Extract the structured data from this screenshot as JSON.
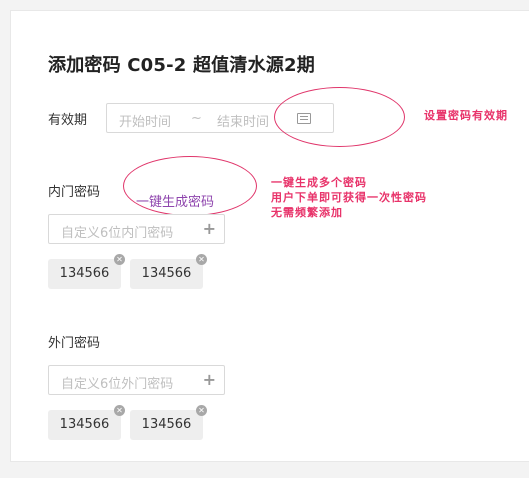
{
  "page": {
    "title": "添加密码 C05-2 超值清水源2期"
  },
  "validity": {
    "label": "有效期",
    "start_placeholder": "开始时间",
    "separator": "~",
    "end_placeholder": "结束时间",
    "icon": "calendar-icon",
    "annotation": "设置密码有效期"
  },
  "inner": {
    "label": "内门密码",
    "generate_link": "一键生成密码",
    "annotation_lines": [
      "一键生成多个密码",
      "用户下单即可获得一次性密码",
      "无需频繁添加"
    ],
    "input_placeholder": "自定义6位内门密码",
    "add_icon": "+",
    "tags": [
      "134566",
      "134566"
    ]
  },
  "outer": {
    "label": "外门密码",
    "input_placeholder": "自定义6位外门密码",
    "add_icon": "+",
    "tags": [
      "134566",
      "134566"
    ]
  },
  "colors": {
    "annotation": "#e8336a",
    "link": "#8e44ad"
  }
}
